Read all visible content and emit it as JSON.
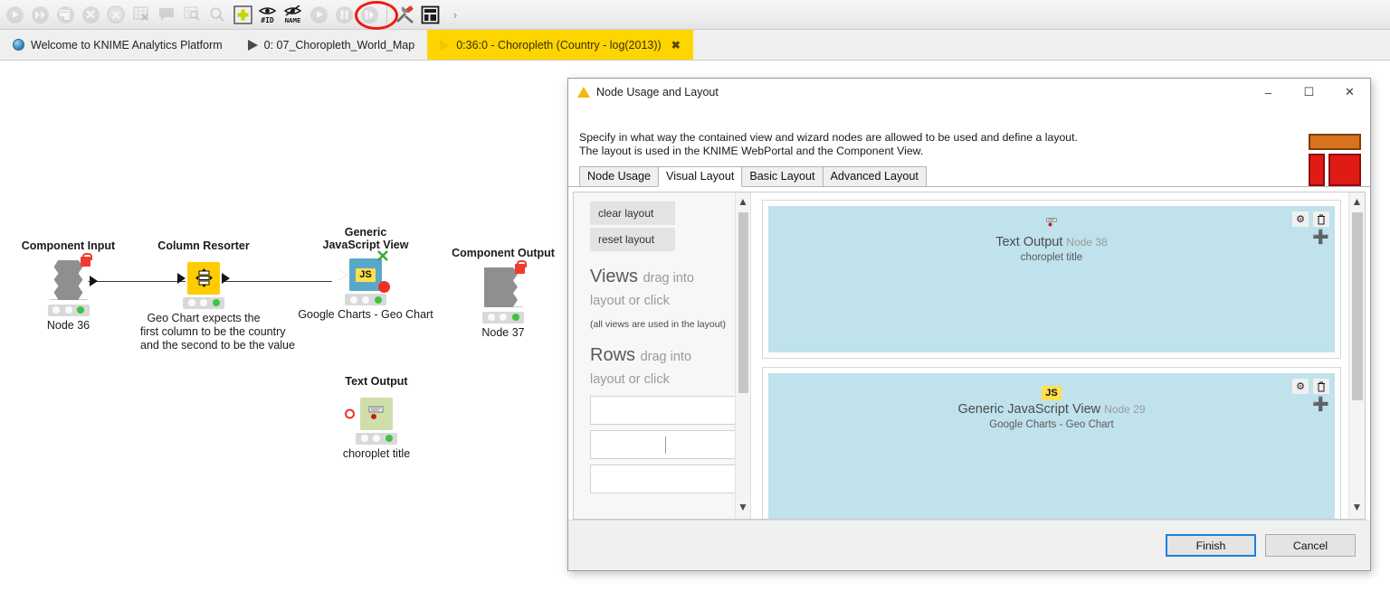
{
  "toolbar": {
    "items": [
      {
        "name": "execute-selected-icon",
        "glyph": "play",
        "enabled": false
      },
      {
        "name": "execute-all-icon",
        "glyph": "fastforward",
        "enabled": false
      },
      {
        "name": "execute-and-open-view-icon",
        "glyph": "execute-open-view",
        "enabled": false
      },
      {
        "name": "cancel-selected-icon",
        "glyph": "cancel",
        "enabled": false
      },
      {
        "name": "cancel-all-icon",
        "glyph": "cancel-all",
        "enabled": false
      },
      {
        "name": "reset-icon",
        "glyph": "table-reset",
        "enabled": false
      },
      {
        "name": "node-comment-icon",
        "glyph": "speech-bubble",
        "enabled": false
      },
      {
        "name": "open-view-icon",
        "glyph": "table-view",
        "enabled": false
      },
      {
        "name": "zoom-icon",
        "glyph": "magnifier",
        "enabled": false
      },
      {
        "name": "add-node-icon",
        "glyph": "add-plus",
        "enabled": true
      },
      {
        "name": "show-node-id-icon",
        "glyph": "eye-id",
        "enabled": true
      },
      {
        "name": "hide-node-name-icon",
        "glyph": "crossed-name",
        "enabled": true
      },
      {
        "name": "step-execute-icon",
        "glyph": "step-play",
        "enabled": false
      },
      {
        "name": "pause-icon",
        "glyph": "pause",
        "enabled": false
      },
      {
        "name": "step-icon",
        "glyph": "step",
        "enabled": false
      },
      {
        "name": "separator",
        "glyph": "separator",
        "enabled": false
      },
      {
        "name": "configure-component-icon",
        "glyph": "wrench-hammer",
        "enabled": true
      },
      {
        "name": "node-usage-and-layout-icon",
        "glyph": "layout",
        "enabled": true
      },
      {
        "name": "toolbar-overflow-chevron-icon",
        "glyph": "chevron-right",
        "enabled": true
      }
    ],
    "highlight_color": "#ee1c14"
  },
  "tabs": [
    {
      "label": "Welcome to KNIME Analytics Platform",
      "icon": "globe-icon",
      "active": false,
      "closable": false
    },
    {
      "label": "0: 07_Choropleth_World_Map",
      "icon": "knime-workflow-icon",
      "active": false,
      "closable": false
    },
    {
      "label": "0:36:0 - Choropleth (Country - log(2013))",
      "icon": "knime-component-icon",
      "active": true,
      "closable": true,
      "close_glyph": "✖"
    }
  ],
  "canvas": {
    "nodes": [
      {
        "name": "component-input-node",
        "title": "Component Input",
        "label": "Node 36",
        "kind": "component-grey",
        "status": "green"
      },
      {
        "name": "column-resorter-node",
        "title": "Column Resorter",
        "label": "Geo Chart expects the\nfirst column to be the country\nand the second to be the value",
        "label_lines": [
          "Geo Chart expects the",
          "first column to be the country",
          "and the second to be the value"
        ],
        "kind": "yellow-square",
        "status": "green"
      },
      {
        "name": "generic-javascript-view-node",
        "title": "Generic\nJavaScript View",
        "title_lines": [
          "Generic",
          "JavaScript View"
        ],
        "label": "Google Charts - Geo Chart",
        "kind": "blue-js",
        "chip": "JS",
        "status": "green"
      },
      {
        "name": "component-output-node",
        "title": "Component Output",
        "label": "Node 37",
        "kind": "component-grey",
        "status": "green"
      },
      {
        "name": "text-output-node",
        "title": "Text Output",
        "label": "choroplet title",
        "kind": "green-square",
        "status": "green"
      }
    ]
  },
  "dialog": {
    "title": "Node Usage and Layout",
    "window_buttons": {
      "minimize": "–",
      "maximize": "☐",
      "close": "✕"
    },
    "description_line1": "Specify in what way the contained view and wizard nodes are allowed to be used and define a layout.",
    "description_line2": "The layout is used in the KNIME WebPortal and the Component View.",
    "tabs": [
      {
        "label": "Node Usage",
        "active": false
      },
      {
        "label": "Visual Layout",
        "active": true
      },
      {
        "label": "Basic Layout",
        "active": false
      },
      {
        "label": "Advanced Layout",
        "active": false
      }
    ],
    "left_panel": {
      "clear_layout_label": "clear layout",
      "reset_layout_label": "reset layout",
      "views_heading": "Views",
      "views_hint_line1": "drag into",
      "views_hint_line2": "layout or click",
      "views_note": "(all views are used in the layout)",
      "rows_heading": "Rows",
      "rows_hint_line1": "drag into",
      "rows_hint_line2": "layout or click",
      "row_placeholders": [
        "",
        "",
        ""
      ]
    },
    "layout_cards": [
      {
        "name": "layout-card-text-output",
        "icon": "text-output-icon",
        "title": "Text Output",
        "node_id": "Node 38",
        "subtitle": "choroplet title",
        "settings_glyph": "⚙",
        "delete_glyph": "🗑",
        "add_glyph": "➕",
        "background": "#bfe2ec"
      },
      {
        "name": "layout-card-generic-javascript-view",
        "icon": "js-chip-icon",
        "chip": "JS",
        "title": "Generic JavaScript View",
        "node_id": "Node 29",
        "subtitle": "Google Charts - Geo Chart",
        "settings_glyph": "⚙",
        "delete_glyph": "🗑",
        "add_glyph": "➕",
        "background": "#bfe2ec"
      }
    ],
    "footer": {
      "finish_label": "Finish",
      "cancel_label": "Cancel",
      "primary_color": "#1f7fd8"
    }
  }
}
